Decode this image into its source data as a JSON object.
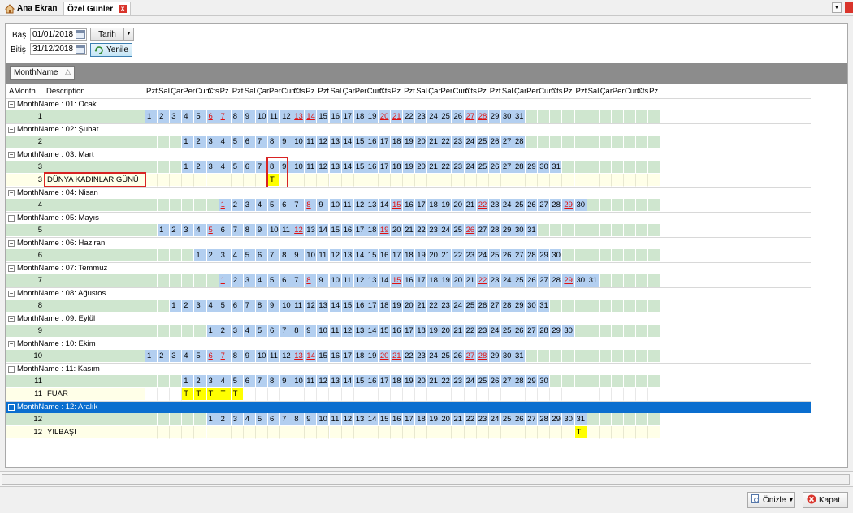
{
  "tabs": {
    "home_label": "Ana Ekran",
    "active_label": "Özel Günler",
    "close_glyph": "x"
  },
  "filters": {
    "start_label": "Baş",
    "start_value": "01/01/2018",
    "end_label": "Bitiş",
    "end_value": "31/12/2018",
    "sort_combo": "Tarih",
    "refresh_label": "Yenile"
  },
  "group_panel": {
    "chip": "MonthName",
    "sort_glyph": "△"
  },
  "grid": {
    "col_amonth": "AMonth",
    "col_desc": "Description",
    "day_headers": [
      "Pzt",
      "Sal",
      "Çar",
      "Per",
      "Cum",
      "Cts",
      "Pz",
      "Pzt",
      "Sal",
      "Çar",
      "Per",
      "Cum",
      "Cts",
      "Pz",
      "Pzt",
      "Sal",
      "Çar",
      "Per",
      "Cum",
      "Cts",
      "Pz",
      "Pzt",
      "Sal",
      "Çar",
      "Per",
      "Cum",
      "Cts",
      "Pz",
      "Pzt",
      "Sal",
      "Çar",
      "Per",
      "Cum",
      "Cts",
      "Pz",
      "Pzt",
      "Sal",
      "Çar",
      "Per",
      "Cum",
      "Cts",
      "Pz"
    ],
    "months": [
      {
        "group": "MonthName : 01: Ocak",
        "amonth": "1",
        "offset": 0,
        "days": 31,
        "events": []
      },
      {
        "group": "MonthName : 02: Şubat",
        "amonth": "2",
        "offset": 3,
        "days": 28,
        "events": []
      },
      {
        "group": "MonthName : 03: Mart",
        "amonth": "3",
        "offset": 3,
        "days": 31,
        "events": [
          {
            "amonth": "3",
            "desc": "DÜNYA KADINLAR GÜNÜ",
            "marks": [
              8
            ],
            "mark_text": "T"
          }
        ]
      },
      {
        "group": "MonthName : 04: Nisan",
        "amonth": "4",
        "offset": 6,
        "days": 30,
        "events": []
      },
      {
        "group": "MonthName : 05: Mayıs",
        "amonth": "5",
        "offset": 1,
        "days": 31,
        "events": []
      },
      {
        "group": "MonthName : 06: Haziran",
        "amonth": "6",
        "offset": 4,
        "days": 30,
        "events": []
      },
      {
        "group": "MonthName : 07: Temmuz",
        "amonth": "7",
        "offset": 6,
        "days": 31,
        "events": []
      },
      {
        "group": "MonthName : 08: Ağustos",
        "amonth": "8",
        "offset": 2,
        "days": 31,
        "events": []
      },
      {
        "group": "MonthName : 09: Eylül",
        "amonth": "9",
        "offset": 5,
        "days": 30,
        "events": []
      },
      {
        "group": "MonthName : 10: Ekim",
        "amonth": "10",
        "offset": 0,
        "days": 31,
        "events": []
      },
      {
        "group": "MonthName : 11: Kasım",
        "amonth": "11",
        "offset": 3,
        "days": 30,
        "events": [
          {
            "amonth": "11",
            "desc": "FUAR",
            "marks": [
              1,
              2,
              3,
              4,
              5
            ],
            "mark_text": "T"
          }
        ]
      },
      {
        "group": "MonthName : 12: Aralık",
        "amonth": "12",
        "offset": 5,
        "days": 31,
        "selected": true,
        "events": [
          {
            "amonth": "12",
            "desc": "YILBAŞI",
            "marks": [
              31
            ],
            "mark_text": "T"
          }
        ]
      }
    ]
  },
  "footer": {
    "preview_label": "Önizle",
    "close_label": "Kapat"
  }
}
